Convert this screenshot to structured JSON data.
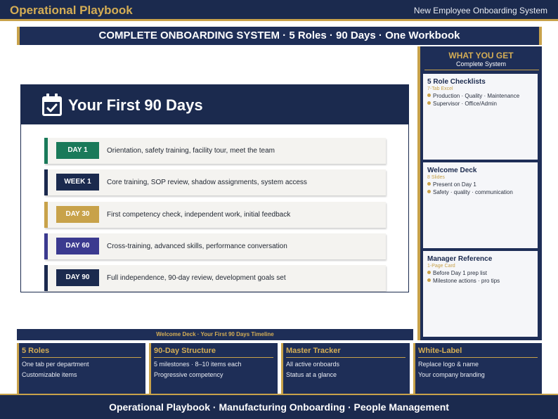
{
  "header": {
    "brand": "Operational Playbook",
    "system": "New Employee Onboarding System"
  },
  "banner": "COMPLETE ONBOARDING SYSTEM  ·  5 Roles  ·  90 Days  ·  One Workbook",
  "slide": {
    "icon": "calendar-check-icon",
    "title": "Your First 90 Days",
    "milestones": [
      {
        "label": "DAY 1",
        "desc": "Orientation, safety training, facility tour, meet the team",
        "color": "#1a7a5a"
      },
      {
        "label": "WEEK 1",
        "desc": "Core training, SOP review, shadow assignments, system access",
        "color": "#1b2a4e"
      },
      {
        "label": "DAY 30",
        "desc": "First competency check, independent work, initial feedback",
        "color": "#c8a24a"
      },
      {
        "label": "DAY 60",
        "desc": "Cross-training, advanced skills, performance conversation",
        "color": "#3b3a8f"
      },
      {
        "label": "DAY 90",
        "desc": "Full independence, 90-day review, development goals set",
        "color": "#1b2a4e"
      }
    ]
  },
  "caption": "Welcome Deck · Your First 90 Days Timeline",
  "what_you_get": {
    "title": "WHAT YOU GET",
    "subtitle": "Complete System",
    "cards": [
      {
        "title": "5 Role Checklists",
        "sub": "7-Tab Excel",
        "items": [
          "Production · Quality · Maintenance",
          "Supervisor · Office/Admin"
        ]
      },
      {
        "title": "Welcome Deck",
        "sub": "8 Slides",
        "items": [
          "Present on Day 1",
          "Safety · quality · communication"
        ]
      },
      {
        "title": "Manager Reference",
        "sub": "1-Page Card",
        "items": [
          "Before Day 1 prep list",
          "Milestone actions · pro tips"
        ]
      }
    ]
  },
  "features": [
    {
      "title": "5 Roles",
      "lines": [
        "One tab per department",
        "Customizable items"
      ]
    },
    {
      "title": "90-Day Structure",
      "lines": [
        "5 milestones · 8–10 items each",
        "Progressive competency"
      ]
    },
    {
      "title": "Master Tracker",
      "lines": [
        "All active onboards",
        "Status at a glance"
      ]
    },
    {
      "title": "White-Label",
      "lines": [
        "Replace logo & name",
        "Your company branding"
      ]
    }
  ],
  "footer": "Operational Playbook  ·  Manufacturing Onboarding  ·  People Management",
  "colors": {
    "navy": "#1b2a4e",
    "gold": "#c8a24a"
  }
}
